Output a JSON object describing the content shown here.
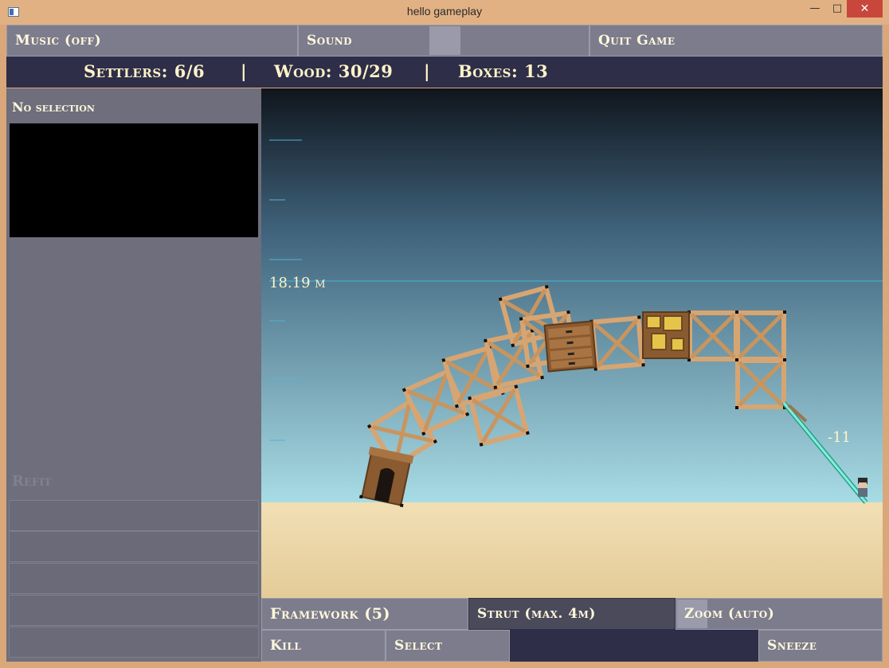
{
  "window": {
    "title": "hello gameplay"
  },
  "top_menu": {
    "music_label": "Music (off)",
    "sound_label": "Sound",
    "sound_level": 0.5,
    "quit_label": "Quit Game"
  },
  "status": {
    "settlers": "Settlers: 6/6",
    "separator": "|",
    "wood": "Wood: 30/29",
    "boxes": "Boxes: 13"
  },
  "side_panel": {
    "selection_label": "No selection",
    "refit_label": "Refit"
  },
  "scene": {
    "height_marker": "18.19 m",
    "score_popup": "-11"
  },
  "bottom_toolbar": {
    "framework_label": "Framework (5)",
    "strut_label": "Strut (max. 4m)",
    "zoom_label": "Zoom (auto)",
    "kill_label": "Kill",
    "select_label": "Select",
    "sneeze_label": "Sneeze"
  },
  "colors": {
    "sky_top": "#11171f",
    "sky_bottom": "#a6dbe4",
    "sand": "#ecd9ad",
    "wood": "#d7a572",
    "panel": "#6e6e7c",
    "status_bar": "#2e2e48",
    "text_cream": "#fff8dc",
    "rope": "#6fe0c8"
  }
}
